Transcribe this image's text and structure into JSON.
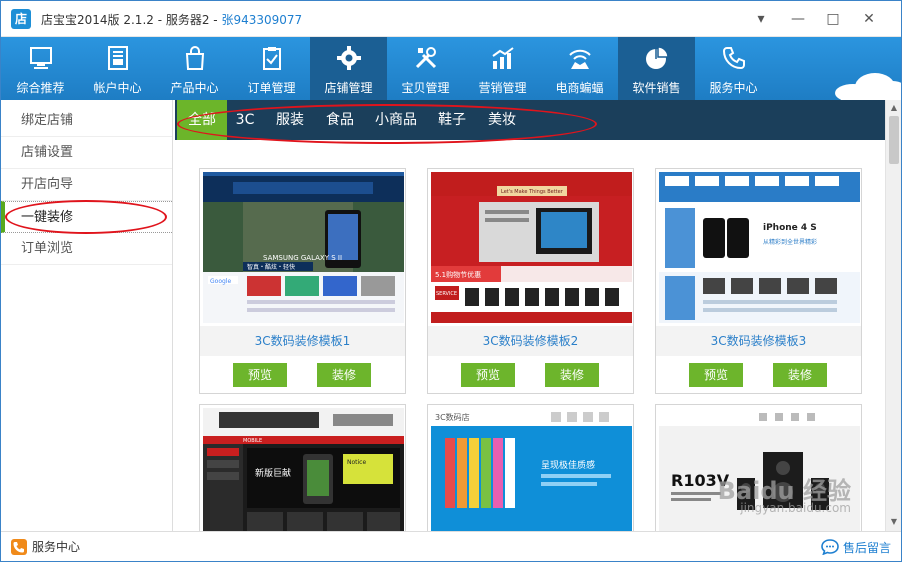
{
  "window": {
    "logo_text": "店",
    "title": "店宝宝2014版 2.1.2 - 服务器2 - ",
    "user": "张943309077",
    "buttons": {
      "menu": "▾",
      "minimize": "—",
      "maximize": "□",
      "close": "✕"
    }
  },
  "nav": {
    "items": [
      {
        "label": "综合推荐",
        "icon": "monitor-icon"
      },
      {
        "label": "帐户中心",
        "icon": "account-card-icon"
      },
      {
        "label": "产品中心",
        "icon": "shopping-bag-icon"
      },
      {
        "label": "订单管理",
        "icon": "clipboard-icon"
      },
      {
        "label": "店铺管理",
        "icon": "gear-icon",
        "active": true
      },
      {
        "label": "宝贝管理",
        "icon": "tools-icon"
      },
      {
        "label": "营销管理",
        "icon": "chart-icon"
      },
      {
        "label": "电商蝙蝠",
        "icon": "wifi-bat-icon"
      },
      {
        "label": "软件销售",
        "icon": "pie-chart-icon"
      },
      {
        "label": "服务中心",
        "icon": "phone-icon"
      }
    ]
  },
  "sidebar": {
    "items": [
      {
        "label": "绑定店铺"
      },
      {
        "label": "店铺设置"
      },
      {
        "label": "开店向导"
      },
      {
        "label": "一键装修",
        "active": true
      },
      {
        "label": "订单浏览"
      }
    ]
  },
  "categories": {
    "tabs": [
      "全部",
      "3C",
      "服装",
      "食品",
      "小商品",
      "鞋子",
      "美妆"
    ],
    "active_index": 0
  },
  "templates": {
    "items": [
      {
        "name": "3C数码装修模板1"
      },
      {
        "name": "3C数码装修模板2"
      },
      {
        "name": "3C数码装修模板3"
      },
      {
        "name": ""
      },
      {
        "name": ""
      },
      {
        "name": ""
      }
    ],
    "preview_label": "预览",
    "decorate_label": "装修",
    "thumb_texts": {
      "t1_brand": "SAMSUNG GALAXY S II",
      "t1_tag": "智真・酷炫・轻快",
      "t1_logo": "Google",
      "t2_header": "Let's Make Things Better",
      "t2_badge": "5.1购物节优惠",
      "t2_service": "SERVICE",
      "t3_title": "iPhone 4 S",
      "t3_sub": "从精彩到全世界精彩",
      "t4_menu": "MOBILE",
      "t4_title": "新版巨献",
      "t4_notice": "Notice",
      "t5_shop": "3C数码店",
      "t5_title": "呈现极佳质感",
      "t6_title": "R103V"
    }
  },
  "colors": {
    "accent_green": "#6db52c",
    "nav_blue": "#2b95df",
    "cat_bar": "#1b3f5b",
    "annotation_red": "#e0141c"
  },
  "footer": {
    "service_label": "服务中心",
    "feedback_label": "售后留言"
  },
  "watermark": {
    "main": "Baidu 经验",
    "url": "jingyan.baidu.com"
  }
}
